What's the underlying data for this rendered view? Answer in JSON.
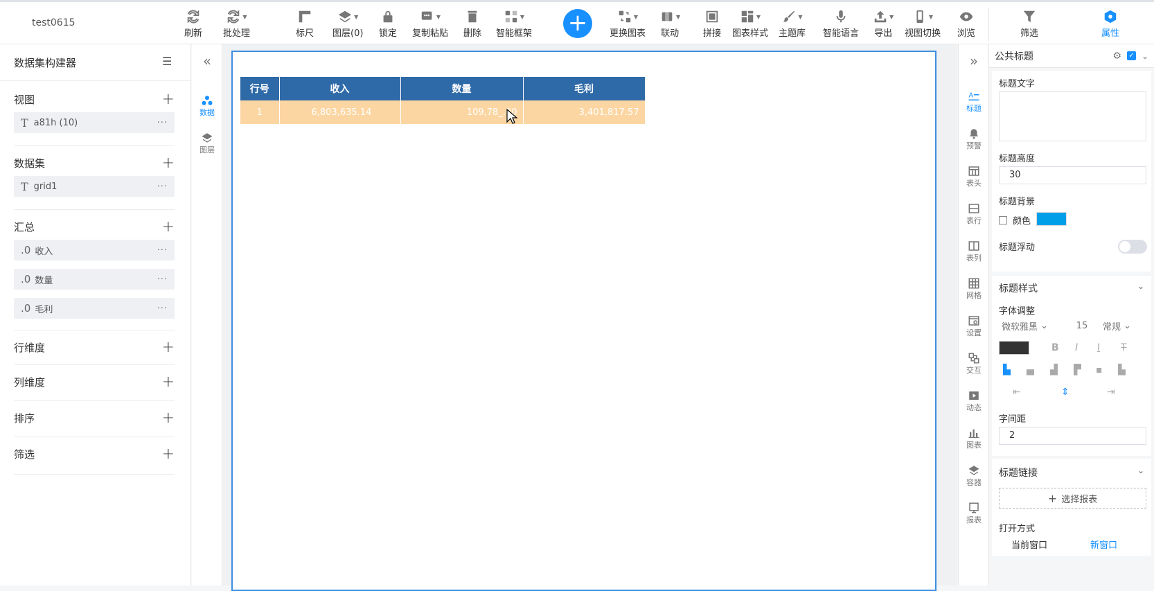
{
  "app": {
    "report_name": "test0615"
  },
  "toolbar": {
    "refresh": "刷新",
    "batch": "批处理",
    "ruler": "标尺",
    "layers": "图层(0)",
    "lock": "锁定",
    "copy_paste": "复制粘贴",
    "delete": "删除",
    "smart_frame": "智能框架",
    "add": "+",
    "change_chart": "更换图表",
    "linkage": "联动",
    "splice": "拼接",
    "chart_style": "图表样式",
    "theme_lib": "主题库",
    "smart_voice": "智能语言",
    "export": "导出",
    "view_switch": "视图切换",
    "browse": "浏览",
    "filter": "筛选",
    "properties": "属性"
  },
  "left_panel": {
    "title": "数据集构建器",
    "view": {
      "label": "视图",
      "item_type": "T",
      "item": "a81h (10)"
    },
    "dataset": {
      "label": "数据集",
      "item_type": "T",
      "item": "grid1"
    },
    "summary": {
      "label": "汇总",
      "items": [
        {
          "type": ".0",
          "name": "收入"
        },
        {
          "type": ".0",
          "name": "数量"
        },
        {
          "type": ".0",
          "name": "毛利"
        }
      ]
    },
    "row_dim": "行维度",
    "col_dim": "列维度",
    "sort": "排序",
    "filter": "筛选",
    "more": "···"
  },
  "left_rail": {
    "data": "数据",
    "layer": "图层"
  },
  "table": {
    "headers": [
      "行号",
      "收入",
      "数量",
      "毛利"
    ],
    "rows": [
      [
        "1",
        "6,803,635.14",
        "109,78_.00",
        "3,401,817.57"
      ]
    ]
  },
  "right_rail": {
    "title": "标题",
    "alert": "预警",
    "header": "表头",
    "row": "表行",
    "column": "表列",
    "grid": "网格",
    "settings": "设置",
    "interact": "交互",
    "animation": "动态",
    "chart": "图表",
    "container": "容器",
    "report": "报表"
  },
  "props": {
    "header": "公共标题",
    "title_text_label": "标题文字",
    "title_height_label": "标题高度",
    "title_height_value": "30",
    "title_bg_label": "标题背景",
    "color_label": "颜色",
    "bg_color": "#009fe8",
    "title_float_label": "标题浮动",
    "title_style_label": "标题样式",
    "font_adjust_label": "字体调整",
    "font_family": "微软雅黑",
    "font_size": "15",
    "font_weight": "常规",
    "font_color": "#333333",
    "letter_spacing_label": "字间距",
    "letter_spacing_value": "2",
    "title_link_label": "标题链接",
    "select_report": "选择报表",
    "open_mode_label": "打开方式",
    "current_window": "当前窗口",
    "new_window": "新窗口"
  }
}
